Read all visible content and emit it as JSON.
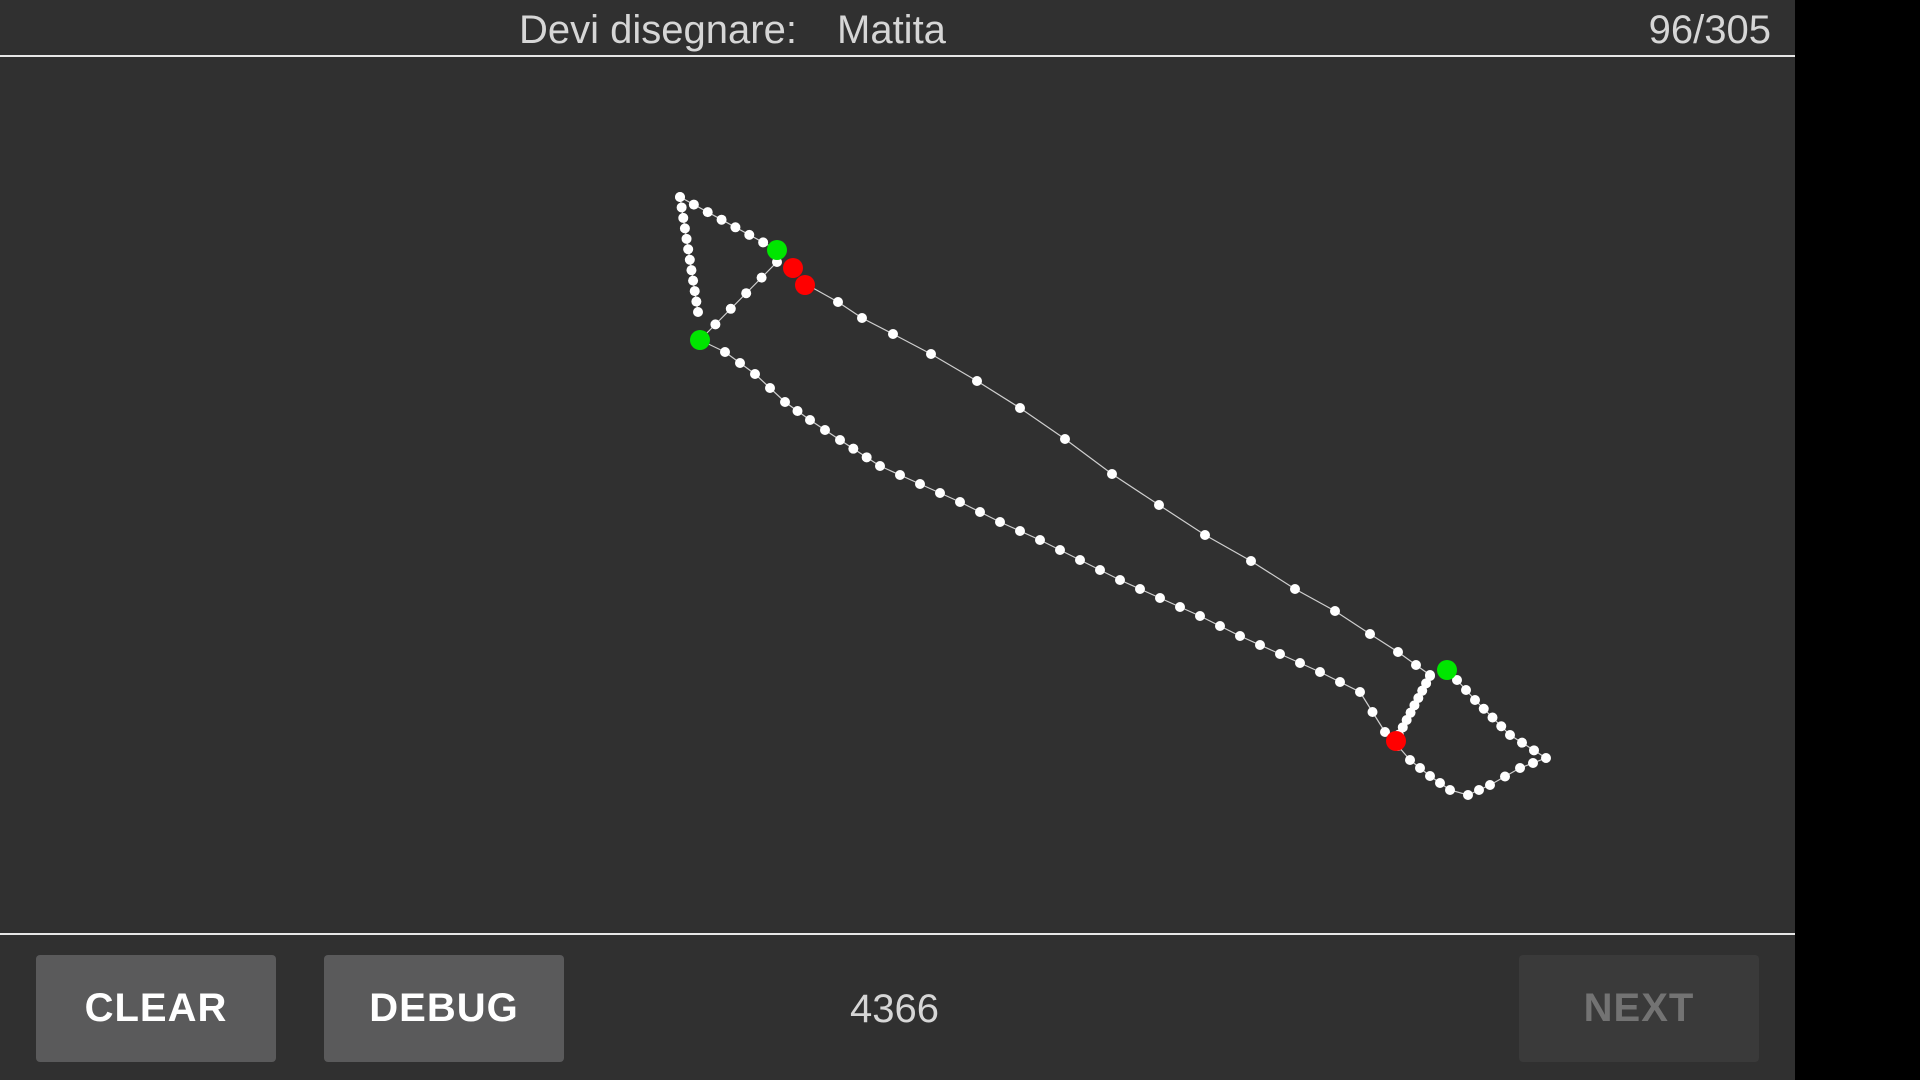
{
  "header": {
    "prompt_label": "Devi disegnare:",
    "prompt_word": "Matita",
    "progress": "96/305"
  },
  "footer": {
    "clear_label": "CLEAR",
    "debug_label": "DEBUG",
    "score": "4366",
    "next_label": "NEXT"
  },
  "colors": {
    "background": "#303030",
    "stroke_point": "#ffffff",
    "stroke_start": "#00e600",
    "stroke_end": "#ff0000"
  }
}
